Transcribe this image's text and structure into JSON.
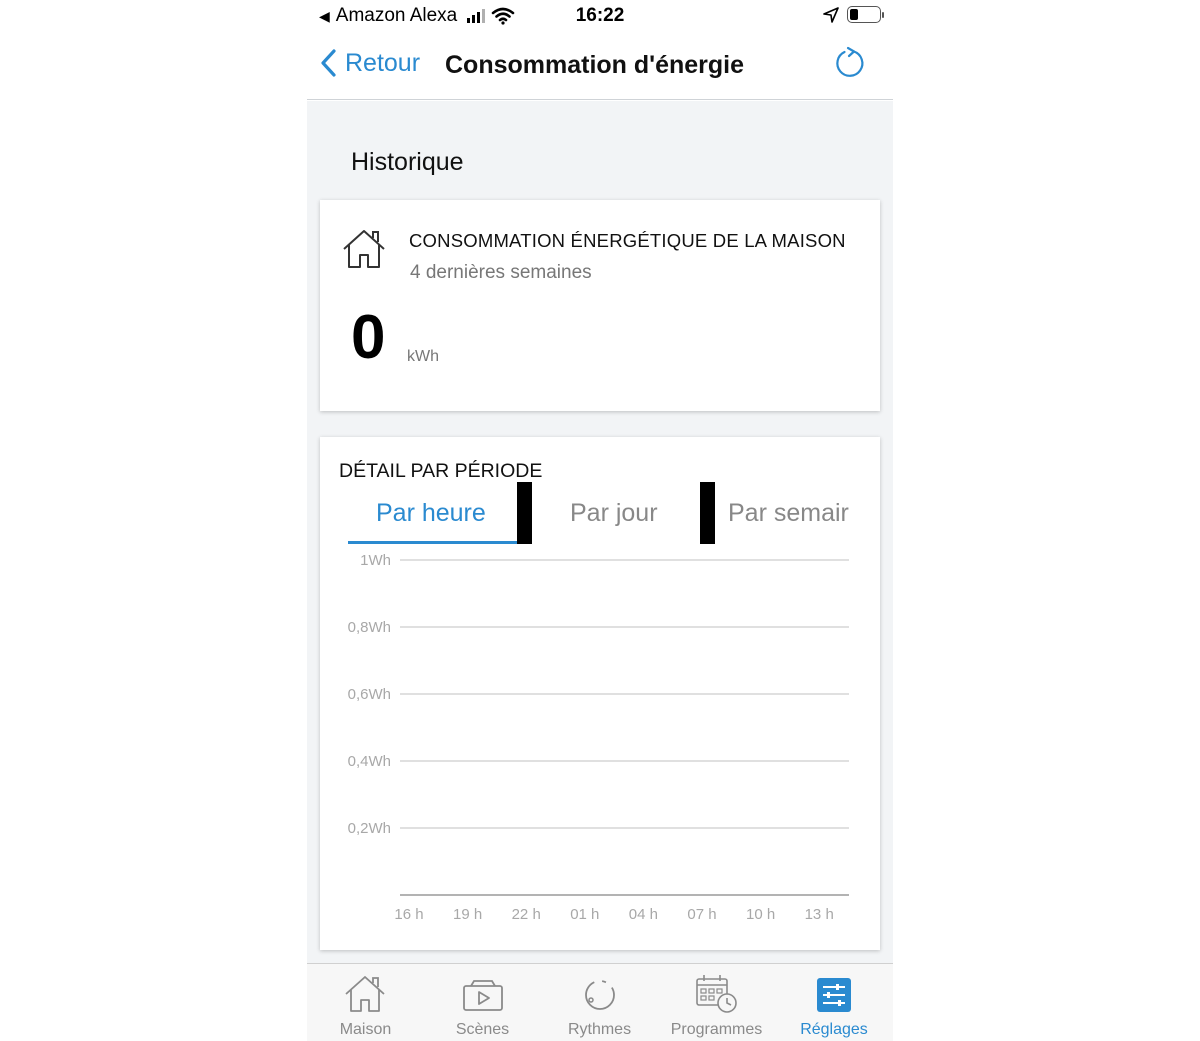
{
  "status_bar": {
    "back_app": "Amazon Alexa",
    "time": "16:22"
  },
  "nav": {
    "back_label": "Retour",
    "title": "Consommation d'énergie"
  },
  "section": {
    "title": "Historique"
  },
  "summary": {
    "title": "CONSOMMATION ÉNERGÉTIQUE DE LA MAISON",
    "subtitle": "4 dernières semaines",
    "value": "0",
    "unit": "kWh"
  },
  "detail": {
    "title": "DÉTAIL PAR PÉRIODE",
    "tabs": [
      {
        "label": "Par heure",
        "active": true
      },
      {
        "label": "Par jour",
        "active": false
      },
      {
        "label": "Par semair",
        "active": false
      }
    ]
  },
  "chart_data": {
    "type": "line",
    "x": [
      "16 h",
      "19 h",
      "22 h",
      "01 h",
      "04 h",
      "07 h",
      "10 h",
      "13 h"
    ],
    "y_ticks": [
      "1Wh",
      "0,8Wh",
      "0,6Wh",
      "0,4Wh",
      "0,2Wh"
    ],
    "y_tick_values": [
      1,
      0.8,
      0.6,
      0.4,
      0.2
    ],
    "ylim": [
      0,
      1
    ],
    "series": [
      {
        "values": [
          0,
          0,
          0,
          0,
          0,
          0,
          0,
          0
        ]
      }
    ],
    "grid": true,
    "colors": {
      "grid": "#d6d6d6",
      "axis": "#9a9a9a",
      "tick_text": "#a8a8a8"
    }
  },
  "tab_bar": {
    "items": [
      {
        "label": "Maison",
        "icon": "house-icon",
        "active": false
      },
      {
        "label": "Scènes",
        "icon": "scenes-icon",
        "active": false
      },
      {
        "label": "Rythmes",
        "icon": "rhythm-icon",
        "active": false
      },
      {
        "label": "Programmes",
        "icon": "calendar-clock-icon",
        "active": false
      },
      {
        "label": "Réglages",
        "icon": "settings-sliders-icon",
        "active": true
      }
    ]
  },
  "colors": {
    "accent": "#2a8ad0",
    "inactive": "#8a8a8a",
    "background": "#f2f4f6"
  }
}
